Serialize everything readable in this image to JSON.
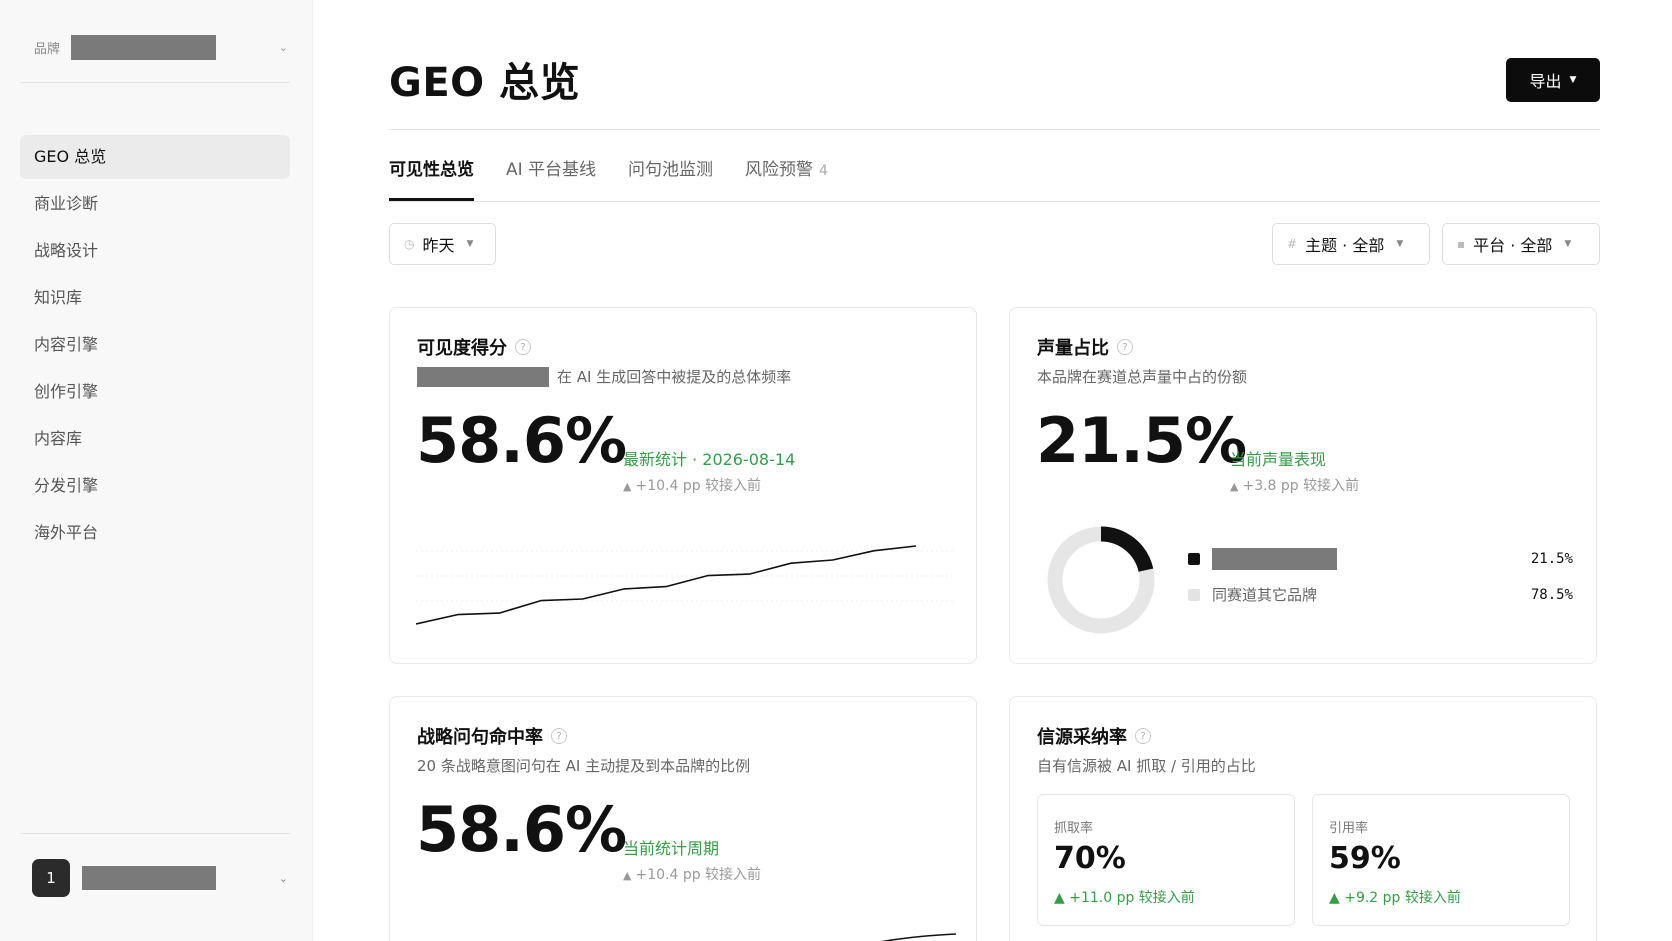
{
  "sidebar": {
    "brand_label": "品牌",
    "nav": [
      {
        "label": "GEO 总览",
        "active": true
      },
      {
        "label": "商业诊断"
      },
      {
        "label": "战略设计"
      },
      {
        "label": "知识库"
      },
      {
        "label": "内容引擎"
      },
      {
        "label": "创作引擎"
      },
      {
        "label": "内容库"
      },
      {
        "label": "分发引擎"
      },
      {
        "label": "海外平台"
      }
    ],
    "user_avatar": "1"
  },
  "header": {
    "title": "GEO 总览",
    "export_label": "导出"
  },
  "tabs": [
    {
      "label": "可见性总览",
      "active": true
    },
    {
      "label": "AI 平台基线"
    },
    {
      "label": "问句池监测"
    },
    {
      "label": "风险预警",
      "count": "4"
    }
  ],
  "filters": {
    "date": "昨天",
    "topic": "主题 · 全部",
    "platform": "平台 · 全部"
  },
  "cards": {
    "visibility": {
      "title": "可见度得分",
      "subtitle": "在 AI 生成回答中被提及的总体频率",
      "value": "58.6%",
      "note": "最新统计 · 2026-08-14",
      "delta": "+10.4 pp 较接入前"
    },
    "share": {
      "title": "声量占比",
      "subtitle": "本品牌在赛道总声量中占的份额",
      "value": "21.5%",
      "note": "当前声量表现",
      "delta": "+3.8 pp 较接入前",
      "legend_other": "同赛道其它品牌",
      "brand_pct": "21.5%",
      "other_pct": "78.5%"
    },
    "hit_rate": {
      "title": "战略问句命中率",
      "subtitle": "20 条战略意图问句在 AI 主动提及到本品牌的比例",
      "value": "58.6%",
      "note": "当前统计周期",
      "delta": "+10.4 pp 较接入前"
    },
    "adoption": {
      "title": "信源采纳率",
      "subtitle": "自有信源被 AI 抓取 / 引用的占比",
      "crawl_label": "抓取率",
      "crawl_value": "70%",
      "crawl_delta": "+11.0 pp 较接入前",
      "cite_label": "引用率",
      "cite_value": "59%",
      "cite_delta": "+9.2 pp 较接入前"
    }
  },
  "chart_data": [
    {
      "type": "line",
      "series": [
        {
          "values": [
            0.0,
            0.12,
            0.14,
            0.3,
            0.32,
            0.45,
            0.48,
            0.62,
            0.64,
            0.78,
            0.82,
            0.94,
            1.0
          ]
        }
      ]
    },
    {
      "type": "pie",
      "categories": [
        "同赛道其它品牌"
      ],
      "values": [
        21.5,
        78.5
      ]
    }
  ],
  "colors": {
    "accent_green": "#3a9a4a",
    "primary_dark": "#0c0c0c",
    "donut_bg": "#e6e6e6"
  }
}
